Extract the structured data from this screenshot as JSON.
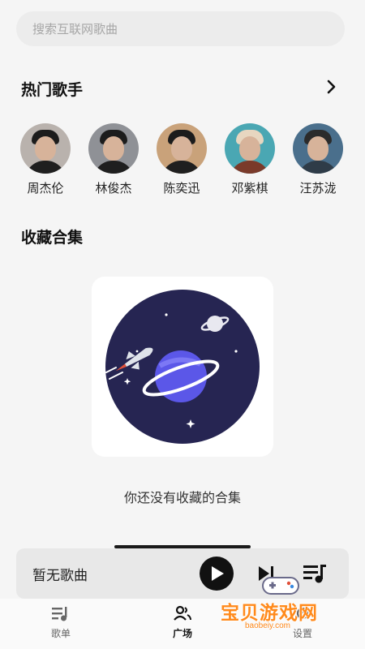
{
  "search": {
    "placeholder": "搜索互联网歌曲"
  },
  "hot_artists": {
    "title": "热门歌手",
    "artists": [
      {
        "name": "周杰伦",
        "bg": "#b9b2ad"
      },
      {
        "name": "林俊杰",
        "bg": "#8f9196"
      },
      {
        "name": "陈奕迅",
        "bg": "#c9a27a"
      },
      {
        "name": "邓紫棋",
        "bg": "#4aa7b3"
      },
      {
        "name": "汪苏泷",
        "bg": "#4a6f8c"
      }
    ]
  },
  "collections": {
    "title": "收藏合集",
    "empty_text": "你还没有收藏的合集"
  },
  "player": {
    "title": "暂无歌曲"
  },
  "tabs": [
    {
      "label": "歌单",
      "active": false
    },
    {
      "label": "广场",
      "active": true
    },
    {
      "label": "设置",
      "active": false
    }
  ],
  "watermark": {
    "text": "宝贝游戏网",
    "url": "baobeiy.com"
  },
  "colors": {
    "illustration_bg": "#262552",
    "planet": "#5b57e8",
    "accent": "#ff8a1c"
  }
}
